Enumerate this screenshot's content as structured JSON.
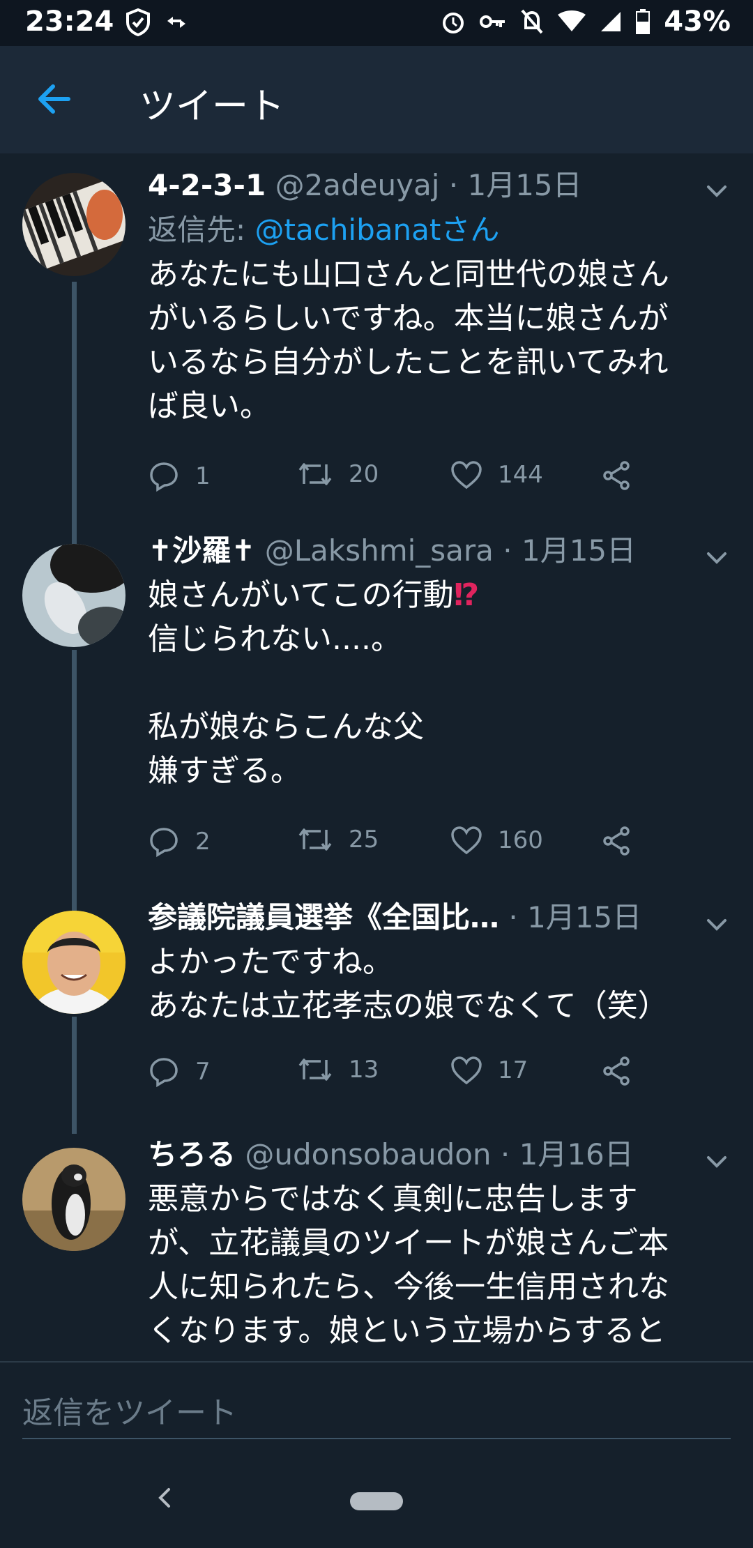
{
  "status_bar": {
    "time": "23:24",
    "battery": "43%",
    "icons": [
      "shield-check-icon",
      "arrows-icon",
      "alarm-icon",
      "key-icon",
      "bell-off-icon",
      "wifi-icon",
      "signal-icon",
      "battery-icon"
    ]
  },
  "app_bar": {
    "title": "ツイート"
  },
  "tweets": [
    {
      "name": "4-2-3-1",
      "handle": "@2adeuyaj",
      "dot": " · ",
      "date": "1月15日",
      "reply_prefix": "返信先: ",
      "reply_to": "@tachibanatさん",
      "text": "あなたにも山口さんと同世代の娘さん\nがいるらしいですね。本当に娘さんが\nいるなら自分がしたことを訊いてみれ\nば良い。",
      "replies": "1",
      "retweets": "20",
      "likes": "144"
    },
    {
      "name": "✝沙羅✝",
      "handle": "@Lakshmi_sara",
      "dot": " · ",
      "date": "1月15日",
      "text_main": "娘さんがいてこの行動",
      "text_emoji": "⁉",
      "text": "信じられない....。\n\n私が娘ならこんな父\n嫌すぎる。",
      "replies": "2",
      "retweets": "25",
      "likes": "160"
    },
    {
      "name": "参議院議員選挙《全国比…",
      "handle": "",
      "dot": " · ",
      "date": "1月15日",
      "text": "よかったですね。\nあなたは立花孝志の娘でなくて（笑）",
      "replies": "7",
      "retweets": "13",
      "likes": "17"
    },
    {
      "name": "ちろる",
      "handle": "@udonsobaudon",
      "dot": " · ",
      "date": "1月16日",
      "text": "悪意からではなく真剣に忠告します\nが、立花議員のツイートが娘さんご本\n人に知られたら、今後一生信用されな\nくなります。娘という立場からすると"
    }
  ],
  "reply_bar": {
    "placeholder": "返信をツイート"
  },
  "colors": {
    "background": "#15202b",
    "header": "#1c2938",
    "accent": "#1da1f2",
    "muted": "#8899a6"
  }
}
